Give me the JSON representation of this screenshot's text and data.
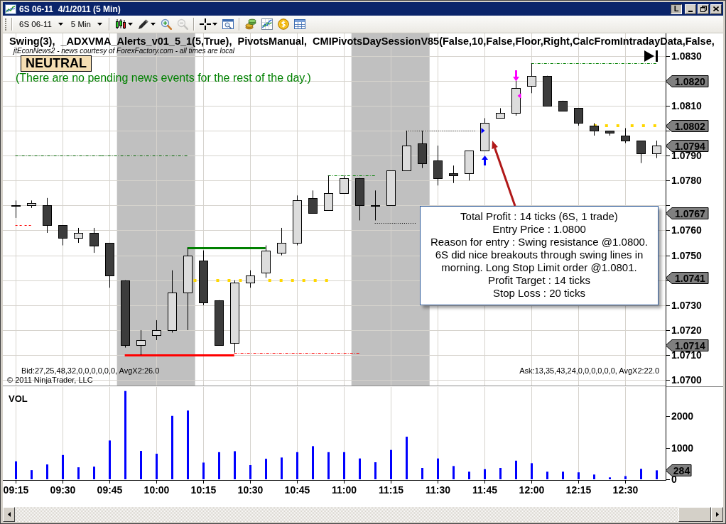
{
  "window": {
    "title": "6S 06-11  4/1/2011 (5 Min)",
    "buttons": [
      {
        "kind": "text",
        "label": "L"
      },
      {
        "kind": "minimize"
      },
      {
        "kind": "restore"
      },
      {
        "kind": "close"
      }
    ]
  },
  "toolbar": {
    "instrument": "6S 06-11",
    "interval": "5 Min",
    "tool_groups": [
      [
        {
          "kind": "bar-style",
          "disabled": false
        },
        {
          "kind": "drawing",
          "disabled": false
        },
        {
          "kind": "zoom-in",
          "disabled": false
        },
        {
          "kind": "zoom-out",
          "disabled": true
        }
      ],
      [
        {
          "kind": "crosshair",
          "disabled": false
        },
        {
          "kind": "data-box",
          "disabled": false
        }
      ],
      [
        {
          "kind": "strategy",
          "disabled": false
        },
        {
          "kind": "indicator",
          "disabled": false
        },
        {
          "kind": "performance",
          "disabled": false
        },
        {
          "kind": "table",
          "disabled": false
        }
      ]
    ]
  },
  "chart": {
    "indicators": "Swing(3),  _ADXVMA_Alerts_v01_5_1(5,True),  PivotsManual,  CMIPivotsDaySessionV85(False,10,False,Floor,Right,CalcFromIntradayData,False,",
    "news_source": "jtEconNews2 - news courtesy of ForexFactory.com - all times are local",
    "bias_label": "NEUTRAL",
    "news_message": "(There are no pending news events for the rest of the day.)",
    "bid_summary": "Bid:27,25,48,32,0,0,0,0,0,0, AvgX2:26.0",
    "ask_summary": "Ask:13,35,43,24,0,0,0,0,0,0, AvgX2:22.0",
    "copyright": "© 2011 NinjaTrader, LLC",
    "price_tags": [
      "1.0820",
      "1.0802",
      "1.0794",
      "1.0767",
      "1.0741",
      "1.0714"
    ],
    "volume_tags": [
      "284"
    ],
    "chart_data": [
      {
        "type": "candlestick",
        "x": [
          "2011-04-01T09:15",
          "2011-04-01T09:20",
          "2011-04-01T09:25",
          "2011-04-01T09:30",
          "2011-04-01T09:35",
          "2011-04-01T09:40",
          "2011-04-01T09:45",
          "2011-04-01T09:50",
          "2011-04-01T09:55",
          "2011-04-01T10:00",
          "2011-04-01T10:05",
          "2011-04-01T10:10",
          "2011-04-01T10:15",
          "2011-04-01T10:20",
          "2011-04-01T10:25",
          "2011-04-01T10:30",
          "2011-04-01T10:35",
          "2011-04-01T10:40",
          "2011-04-01T10:45",
          "2011-04-01T10:50",
          "2011-04-01T10:55",
          "2011-04-01T11:00",
          "2011-04-01T11:05",
          "2011-04-01T11:10",
          "2011-04-01T11:15",
          "2011-04-01T11:20",
          "2011-04-01T11:25",
          "2011-04-01T11:30",
          "2011-04-01T11:35",
          "2011-04-01T11:40",
          "2011-04-01T11:45",
          "2011-04-01T11:50",
          "2011-04-01T11:55",
          "2011-04-01T12:00",
          "2011-04-01T12:05",
          "2011-04-01T12:10",
          "2011-04-01T12:15",
          "2011-04-01T12:20",
          "2011-04-01T12:25",
          "2011-04-01T12:30",
          "2011-04-01T12:35",
          "2011-04-01T12:40"
        ],
        "ohlc": [
          [
            1.077,
            1.0772,
            1.0765,
            1.077
          ],
          [
            1.077,
            1.0772,
            1.0769,
            1.0771
          ],
          [
            1.077,
            1.0773,
            1.0759,
            1.0762
          ],
          [
            1.0762,
            1.0762,
            1.0754,
            1.0757
          ],
          [
            1.0757,
            1.0761,
            1.0755,
            1.0759
          ],
          [
            1.0759,
            1.0761,
            1.0751,
            1.0754
          ],
          [
            1.0755,
            1.0755,
            1.0737,
            1.0742
          ],
          [
            1.074,
            1.074,
            1.0713,
            1.0714
          ],
          [
            1.0714,
            1.072,
            1.071,
            1.0716
          ],
          [
            1.0718,
            1.0724,
            1.0716,
            1.072
          ],
          [
            1.072,
            1.0744,
            1.0719,
            1.0735
          ],
          [
            1.0735,
            1.0753,
            1.072,
            1.075
          ],
          [
            1.0748,
            1.0752,
            1.073,
            1.0731
          ],
          [
            1.0732,
            1.0732,
            1.0714,
            1.0714
          ],
          [
            1.0715,
            1.074,
            1.0711,
            1.0739
          ],
          [
            1.0739,
            1.0744,
            1.0737,
            1.0742
          ],
          [
            1.0743,
            1.0754,
            1.0741,
            1.0752
          ],
          [
            1.0751,
            1.0761,
            1.075,
            1.0755
          ],
          [
            1.0755,
            1.0774,
            1.0754,
            1.0772
          ],
          [
            1.0773,
            1.0776,
            1.0767,
            1.0767
          ],
          [
            1.0768,
            1.0782,
            1.0768,
            1.0775
          ],
          [
            1.0775,
            1.0782,
            1.0775,
            1.0781
          ],
          [
            1.0781,
            1.0781,
            1.0764,
            1.077
          ],
          [
            1.077,
            1.0776,
            1.0764,
            1.077
          ],
          [
            1.077,
            1.0784,
            1.077,
            1.0784
          ],
          [
            1.0784,
            1.08,
            1.0784,
            1.0794
          ],
          [
            1.0795,
            1.08,
            1.0785,
            1.0787
          ],
          [
            1.0788,
            1.0794,
            1.0778,
            1.0781
          ],
          [
            1.0783,
            1.0786,
            1.0779,
            1.0782
          ],
          [
            1.0783,
            1.0792,
            1.078,
            1.0792
          ],
          [
            1.0792,
            1.0805,
            1.0792,
            1.0803
          ],
          [
            1.0805,
            1.0809,
            1.0805,
            1.0807
          ],
          [
            1.0807,
            1.082,
            1.0806,
            1.0817
          ],
          [
            1.0818,
            1.0827,
            1.0815,
            1.0822
          ],
          [
            1.0822,
            1.0822,
            1.081,
            1.081
          ],
          [
            1.0812,
            1.0812,
            1.0808,
            1.0808
          ],
          [
            1.0809,
            1.0809,
            1.0802,
            1.0803
          ],
          [
            1.0802,
            1.0803,
            1.0798,
            1.08
          ],
          [
            1.08,
            1.08,
            1.0798,
            1.0799
          ],
          [
            1.0798,
            1.0801,
            1.0795,
            1.0796
          ],
          [
            1.0796,
            1.0796,
            1.0787,
            1.0791
          ],
          [
            1.0791,
            1.0796,
            1.0789,
            1.0794
          ]
        ],
        "xlim": [
          "2011-04-01T09:11",
          "2011-04-01T12:43"
        ],
        "ylim": [
          1.06975,
          1.0839
        ],
        "yticks": [
          {
            "value": 1.07,
            "label": "1.0700"
          },
          {
            "value": 1.071,
            "label": "1.0710"
          },
          {
            "value": 1.072,
            "label": "1.0720"
          },
          {
            "value": 1.073,
            "label": "1.0730"
          },
          {
            "value": 1.075,
            "label": "1.0750"
          },
          {
            "value": 1.076,
            "label": "1.0760"
          },
          {
            "value": 1.078,
            "label": "1.0780"
          },
          {
            "value": 1.079,
            "label": "1.0790"
          },
          {
            "value": 1.081,
            "label": "1.0810"
          },
          {
            "value": 1.083,
            "label": "1.0830"
          }
        ],
        "xticks": [
          "2011-04-01T09:15",
          "2011-04-01T09:30",
          "2011-04-01T09:45",
          "2011-04-01T10:00",
          "2011-04-01T10:15",
          "2011-04-01T10:30",
          "2011-04-01T10:45",
          "2011-04-01T11:00",
          "2011-04-01T11:15",
          "2011-04-01T11:30",
          "2011-04-01T11:45",
          "2011-04-01T12:00",
          "2011-04-01T12:15",
          "2011-04-01T12:30"
        ],
        "tick_labels": "y",
        "grid": true,
        "bands": [
          {
            "axis": "x",
            "from": "2011-04-01T09:47:30",
            "to": "2011-04-01T10:12:30",
            "color": "#c0c0c0"
          },
          {
            "axis": "x",
            "from": "2011-04-01T11:02:30",
            "to": "2011-04-01T11:27:30",
            "color": "#c0c0c0"
          }
        ],
        "series": [
          {
            "type": "line",
            "x": [
              "2011-04-01T12:00",
              "2011-04-01T12:40"
            ],
            "values": [
              1.0827,
              1.0827
            ],
            "color": "#008000",
            "line_style": "dash-dot"
          },
          {
            "type": "line",
            "x": [
              "2011-04-01T09:15",
              "2011-04-01T10:10"
            ],
            "values": [
              1.079,
              1.079
            ],
            "color": "#006400",
            "line_style": "dash-dot"
          },
          {
            "type": "line",
            "x": [
              "2011-04-01T10:55",
              "2011-04-01T11:10"
            ],
            "values": [
              1.0782,
              1.0782
            ],
            "color": "#008000",
            "line_style": "dash-dot"
          },
          {
            "type": "line",
            "x": [
              "2011-04-01T11:20",
              "2011-04-01T11:42"
            ],
            "values": [
              1.08,
              1.08
            ],
            "color": "#000000",
            "line_style": "dotted"
          },
          {
            "type": "line",
            "x": [
              "2011-04-01T11:10",
              "2011-04-01T11:23"
            ],
            "values": [
              1.0763,
              1.0763
            ],
            "color": "#000000",
            "line_style": "dotted"
          },
          {
            "type": "line",
            "x": [
              "2011-04-01T09:15",
              "2011-04-01T09:20"
            ],
            "values": [
              1.0762,
              1.0762
            ],
            "color": "#ff0000",
            "line_style": "dashed"
          },
          {
            "type": "line",
            "x": [
              "2011-04-01T12:20",
              "2011-04-01T12:40"
            ],
            "values": [
              1.0802,
              1.0802
            ],
            "color": "#ffd700",
            "line_style": "square-dotted"
          },
          {
            "type": "line",
            "x": [
              "2011-04-01T10:10",
              "2011-04-01T10:35"
            ],
            "values": [
              1.0753,
              1.0753
            ],
            "color": "#008000",
            "line_style": "solid"
          },
          {
            "type": "line",
            "x": [
              "2011-04-01T10:12",
              "2011-04-01T10:55"
            ],
            "values": [
              1.074,
              1.074
            ],
            "color": "#ffd700",
            "line_style": "square-dotted"
          },
          {
            "type": "line",
            "x": [
              "2011-04-01T10:25",
              "2011-04-01T11:05"
            ],
            "values": [
              1.0711,
              1.0711
            ],
            "color": "#ff0000",
            "line_style": "dash-dot"
          },
          {
            "type": "line",
            "x": [
              "2011-04-01T09:50",
              "2011-04-01T10:25"
            ],
            "values": [
              1.071,
              1.071
            ],
            "color": "#ff0000",
            "line_style": "solid"
          }
        ],
        "annotations": [
          "Total Profit : 14 ticks (6S, 1 trade)",
          "Entry Price : 1.0800",
          "Reason for entry : Swing resistance @1.0800.",
          "6S did nice breakouts through swing lines in",
          "morning. Long Stop Limit order @1.0801.",
          "Profit Target : 14 ticks",
          "Stop Loss : 20 ticks"
        ]
      },
      {
        "type": "bar",
        "title": "VOL",
        "x": [
          "2011-04-01T09:15",
          "2011-04-01T09:20",
          "2011-04-01T09:25",
          "2011-04-01T09:30",
          "2011-04-01T09:35",
          "2011-04-01T09:40",
          "2011-04-01T09:45",
          "2011-04-01T09:50",
          "2011-04-01T09:55",
          "2011-04-01T10:00",
          "2011-04-01T10:05",
          "2011-04-01T10:10",
          "2011-04-01T10:15",
          "2011-04-01T10:20",
          "2011-04-01T10:25",
          "2011-04-01T10:30",
          "2011-04-01T10:35",
          "2011-04-01T10:40",
          "2011-04-01T10:45",
          "2011-04-01T10:50",
          "2011-04-01T10:55",
          "2011-04-01T11:00",
          "2011-04-01T11:05",
          "2011-04-01T11:10",
          "2011-04-01T11:15",
          "2011-04-01T11:20",
          "2011-04-01T11:25",
          "2011-04-01T11:30",
          "2011-04-01T11:35",
          "2011-04-01T11:40",
          "2011-04-01T11:45",
          "2011-04-01T11:50",
          "2011-04-01T11:55",
          "2011-04-01T12:00",
          "2011-04-01T12:05",
          "2011-04-01T12:10",
          "2011-04-01T12:15",
          "2011-04-01T12:20",
          "2011-04-01T12:25",
          "2011-04-01T12:30",
          "2011-04-01T12:35",
          "2011-04-01T12:40"
        ],
        "values": [
          570,
          290,
          470,
          770,
          380,
          400,
          1230,
          2800,
          900,
          810,
          2010,
          2180,
          530,
          860,
          890,
          450,
          650,
          690,
          860,
          1050,
          860,
          860,
          660,
          540,
          930,
          1350,
          360,
          660,
          420,
          240,
          320,
          360,
          590,
          510,
          240,
          240,
          220,
          150,
          60,
          100,
          330,
          284
        ],
        "color": "#0000ff",
        "xlim": [
          "2011-04-01T09:11",
          "2011-04-01T12:43"
        ],
        "ylim": [
          0,
          2950
        ],
        "yticks": [
          0,
          1000,
          2000
        ],
        "xticks": [
          {
            "value": "2011-04-01T09:15",
            "label": "09:15"
          },
          {
            "value": "2011-04-01T09:30",
            "label": "09:30"
          },
          {
            "value": "2011-04-01T09:45",
            "label": "09:45"
          },
          {
            "value": "2011-04-01T10:00",
            "label": "10:00"
          },
          {
            "value": "2011-04-01T10:15",
            "label": "10:15"
          },
          {
            "value": "2011-04-01T10:30",
            "label": "10:30"
          },
          {
            "value": "2011-04-01T10:45",
            "label": "10:45"
          },
          {
            "value": "2011-04-01T11:00",
            "label": "11:00"
          },
          {
            "value": "2011-04-01T11:15",
            "label": "11:15"
          },
          {
            "value": "2011-04-01T11:30",
            "label": "11:30"
          },
          {
            "value": "2011-04-01T11:45",
            "label": "11:45"
          },
          {
            "value": "2011-04-01T12:00",
            "label": "12:00"
          },
          {
            "value": "2011-04-01T12:15",
            "label": "12:15"
          },
          {
            "value": "2011-04-01T12:30",
            "label": "12:30"
          }
        ],
        "grid": true
      }
    ]
  }
}
